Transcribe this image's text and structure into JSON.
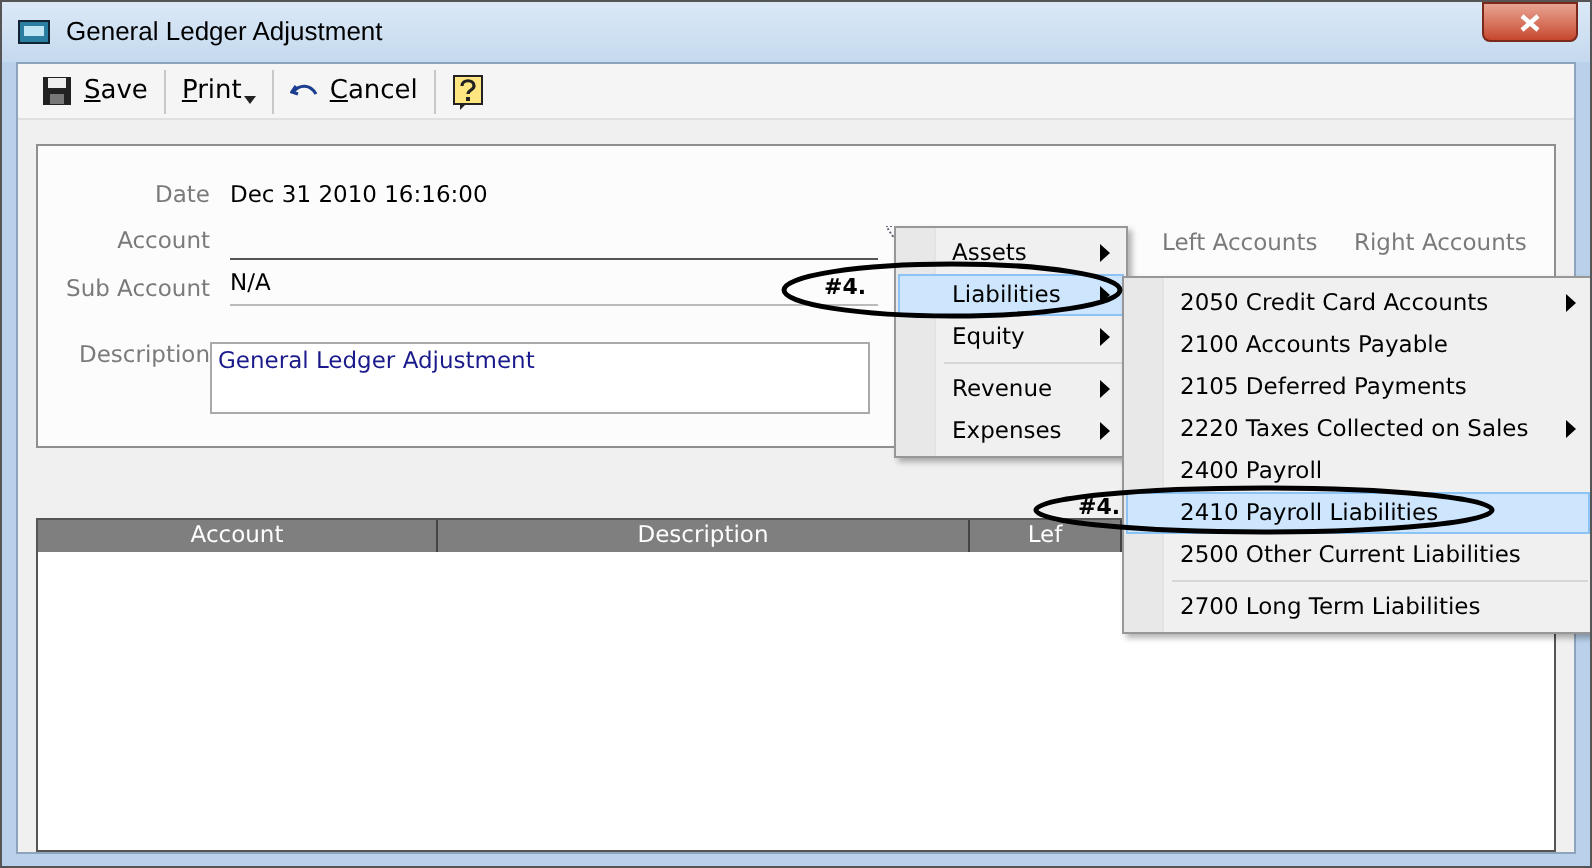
{
  "window": {
    "title": "General Ledger Adjustment"
  },
  "toolbar": [
    {
      "kind": "save",
      "label": "Save"
    },
    {
      "kind": "dropdown",
      "label": "Print"
    },
    {
      "kind": "cancel",
      "label": "Cancel"
    },
    {
      "kind": "help"
    }
  ],
  "form": {
    "date_label": "Date",
    "date_value": "Dec 31 2010 16:16:00",
    "account_label": "Account",
    "sub_account_label": "Sub Account",
    "sub_account_value": "N/A",
    "description_label": "Description",
    "description_value": "General Ledger Adjustment"
  },
  "totals": {
    "left_header": "Left Accounts",
    "right_header": "Right Accounts"
  },
  "table": {
    "columns": [
      "Account",
      "Description",
      "Lef"
    ]
  },
  "menu": [
    {
      "label": "Assets",
      "submenu": true,
      "selected": false
    },
    {
      "label": "Liabilities",
      "submenu": true,
      "selected": true
    },
    {
      "label": "Equity",
      "submenu": true,
      "selected": false
    },
    {
      "kind": "separator"
    },
    {
      "label": "Revenue",
      "submenu": true,
      "selected": false
    },
    {
      "label": "Expenses",
      "submenu": true,
      "selected": false
    }
  ],
  "submenu": [
    {
      "label": "2050 Credit Card Accounts",
      "submenu": true,
      "selected": false
    },
    {
      "label": "2100 Accounts Payable",
      "submenu": false,
      "selected": false
    },
    {
      "label": "2105 Deferred Payments",
      "submenu": false,
      "selected": false
    },
    {
      "label": "2220 Taxes Collected on Sales",
      "submenu": true,
      "selected": false
    },
    {
      "label": "2400 Payroll",
      "submenu": false,
      "selected": false
    },
    {
      "label": "2410 Payroll Liabilities",
      "submenu": false,
      "selected": true
    },
    {
      "label": "2500 Other Current Liabilities",
      "submenu": false,
      "selected": false
    },
    {
      "kind": "separator"
    },
    {
      "label": "2700 Long Term Liabilities",
      "submenu": false,
      "selected": false
    }
  ],
  "annotations": [
    "#4.",
    "#4."
  ]
}
